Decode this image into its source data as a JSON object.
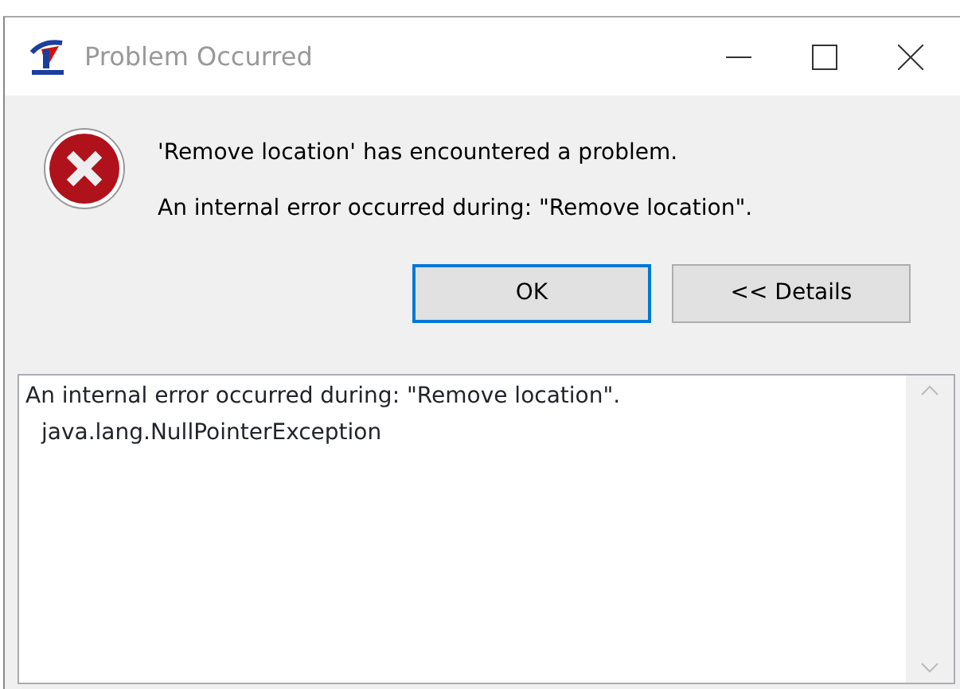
{
  "window": {
    "title": "Problem Occurred"
  },
  "message": {
    "title": "'Remove location' has encountered a problem.",
    "detail": "An internal error occurred during: \"Remove location\"."
  },
  "buttons": [
    {
      "label": "OK",
      "default": true
    },
    {
      "label": "<< Details",
      "default": false
    }
  ],
  "details": {
    "lines": [
      {
        "text": "An internal error occurred during: \"Remove location\".",
        "indented": false
      },
      {
        "text": "java.lang.NullPointerException",
        "indented": true
      }
    ]
  }
}
